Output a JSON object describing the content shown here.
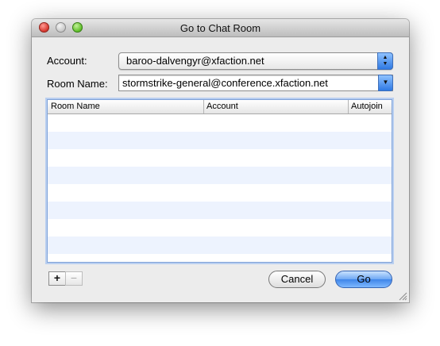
{
  "window": {
    "title": "Go to Chat Room"
  },
  "form": {
    "account_label": "Account:",
    "account_value": "baroo-dalvengyr@xfaction.net",
    "room_label": "Room Name:",
    "room_value": "stormstrike-general@conference.xfaction.net"
  },
  "table": {
    "columns": [
      "Room Name",
      "Account",
      "Autojoin"
    ],
    "rows": []
  },
  "controls": {
    "add_label": "+",
    "remove_label": "−",
    "cancel_label": "Cancel",
    "go_label": "Go"
  },
  "colors": {
    "default_button": "#3f85e9",
    "row_alternate": "#edf3fe",
    "focus_ring": "#7fa2d8"
  },
  "icons": [
    "close-icon",
    "minimize-icon",
    "zoom-icon",
    "stepper-icon",
    "chevron-down-icon",
    "resize-grip-icon"
  ]
}
